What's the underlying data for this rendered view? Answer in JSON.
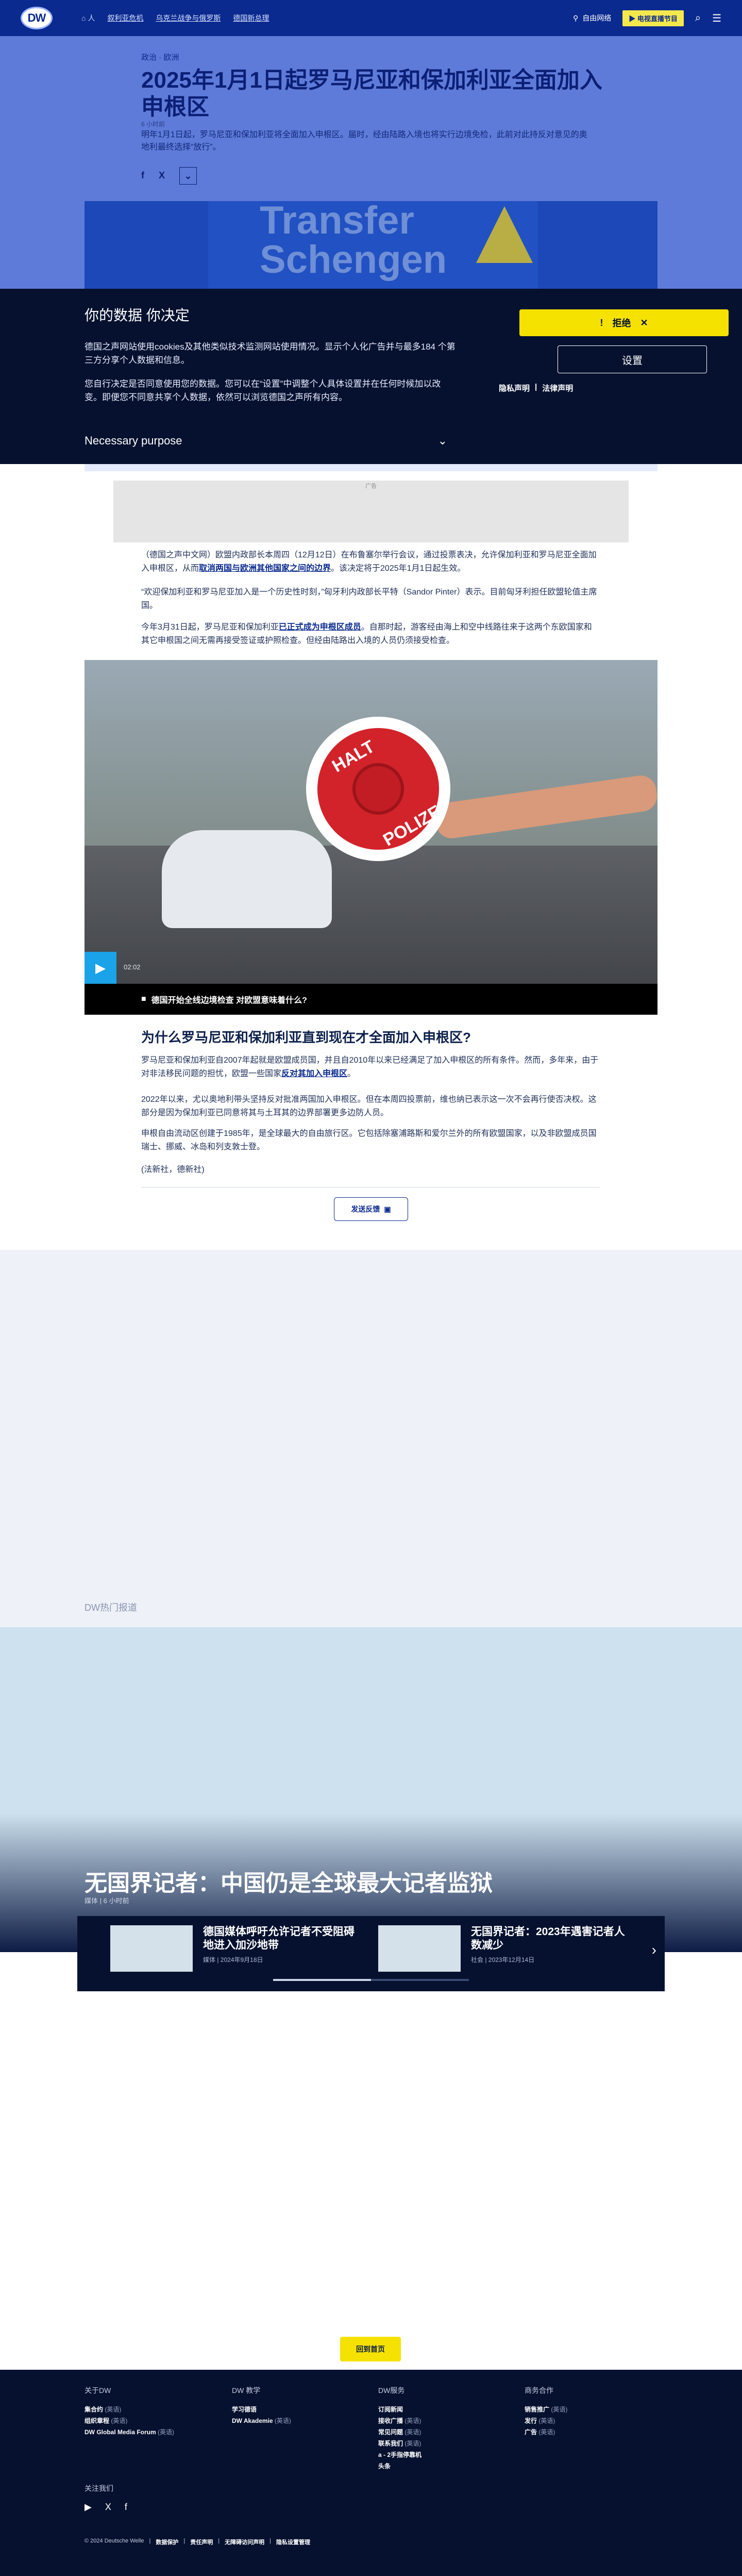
{
  "header": {
    "logo_text": "DW",
    "nav_home": "⌂ 人",
    "nav_links": [
      "叙利亚危机",
      "乌克兰战争与俄罗斯",
      "德国新总理"
    ],
    "language_label": "自由网络",
    "live_button": "电视直播节目",
    "icons": [
      "search-icon",
      "menu-icon"
    ]
  },
  "hero": {
    "kicker": "政治 · 欧洲",
    "headline": "2025年1月1日起罗马尼亚和保加利亚全面加入申根区",
    "date": "6 小时前",
    "teaser": "明年1月1日起，罗马尼亚和保加利亚将全面加入申根区。届时，经由陆路入境也将实行边境免检，此前对此持反对意见的奥地利最终选择“放行”。",
    "share": [
      "f",
      "X",
      "⌄"
    ],
    "image_text": "Transfer Schengen"
  },
  "cookie": {
    "title": "你的数据 你决定",
    "text1": "德国之声网站使用cookies及其他类似技术监测网站使用情况。显示个人化广告并与最多184 个第三方分享个人数据和信息。",
    "text2": "您自行决定是否同意使用您的数据。您可以在“设置”中调整个人具体设置并在任何时候加以改变。即便您不同意共享个人数据，依然可以浏览德国之声所有内容。",
    "reject_button": "拒绝",
    "settings_button": "设置",
    "links": [
      "隐私声明",
      "法律声明"
    ],
    "purpose_label": "Necessary purpose"
  },
  "article": {
    "ad_label": "广告",
    "paragraphs": [
      {
        "text": "（德国之声中文网）欧盟内政部长本周四（12月12日）在布鲁塞尔举行会议，通过投票表决，允许保加利亚和罗马尼亚全面加入申根区，从而",
        "link": "取消两国与欧洲其他国家之间的边界",
        "after": "。该决定将于2025年1月1日起生效。"
      },
      {
        "text": "“欢迎保加利亚和罗马尼亚加入是一个历史性时刻，”匈牙利内政部长平特（Sandor Pinter）表示。目前匈牙利担任欧盟轮值主席国。",
        "link": "",
        "after": ""
      },
      {
        "text": "今年3月31日起，罗马尼亚和保加利亚",
        "link": "已正式成为申根区成员",
        "after": "。自那时起，游客经由海上和空中线路往来于这两个东欧国家和其它申根国之间无需再接受签证或护照检查。但经由陆路出入境的人员仍须接受检查。"
      }
    ],
    "video": {
      "duration": "02:02",
      "caption": "德国开始全线边境检查 对欧盟意味着什么?",
      "sign_top": "HALT",
      "sign_bottom": "POLIZEI"
    },
    "subheading": "为什么罗马尼亚和保加利亚直到现在才全面加入申根区?",
    "paragraphs2": [
      {
        "text": "罗马尼亚和保加利亚自2007年起就是欧盟成员国，并且自2010年以来已经满足了加入申根区的所有条件。然而，多年来，由于对非法移民问题的担忧，欧盟一些国家",
        "link": "反对其加入申根区",
        "after": "。"
      },
      {
        "text": "2022年以来，尤以奥地利带头坚持反对批准两国加入申根区。但在本周四投票前，维也纳已表示这一次不会再行使否决权。这部分是因为保加利亚已同意将其与土耳其的边界部署更多边防人员。",
        "link": "",
        "after": ""
      },
      {
        "text": "申根自由流动区创建于1985年，是全球最大的自由旅行区。它包括除塞浦路斯和爱尔兰外的所有欧盟国家，以及非欧盟成员国瑞士、挪威、冰岛和列支敦士登。",
        "link": "",
        "after": ""
      },
      {
        "text": "(法新社，德新社)",
        "link": "",
        "after": ""
      }
    ],
    "feedback_button": "发送反馈"
  },
  "related": {
    "section_label": "DW热门报道",
    "feature_title": "无国界记者：中国仍是全球最大记者监狱",
    "feature_meta": "媒体 | 6 小时前",
    "cards": [
      {
        "title": "德国媒体呼吁允许记者不受阻碍地进入加沙地带",
        "meta": "媒体 | 2024年9月18日"
      },
      {
        "title": "无国界记者：2023年遇害记者人数减少",
        "meta": "社会 | 2023年12月14日"
      }
    ],
    "carousel_progress": 0.5
  },
  "back_to_top": "回到首页",
  "footer": {
    "columns": [
      {
        "head": "关于DW",
        "items": [
          {
            "label": "集合约",
            "note": "(英语)"
          },
          {
            "label": "组织章程",
            "note": "(英语)"
          },
          {
            "label": "DW Global Media Forum",
            "note": "(英语)"
          }
        ]
      },
      {
        "head": "DW 教学",
        "items": [
          {
            "label": "学习德语",
            "note": ""
          },
          {
            "label": "DW Akademie",
            "note": "(英语)"
          }
        ]
      },
      {
        "head": "DW服务",
        "items": [
          {
            "label": "订阅新闻",
            "note": ""
          },
          {
            "label": "接收广播",
            "note": "(英语)"
          },
          {
            "label": "常见问题",
            "note": "(英语)"
          },
          {
            "label": "联系我们",
            "note": "(英语)"
          },
          {
            "label": "a - 2手指停靠机",
            "note": ""
          },
          {
            "label": "头条",
            "note": ""
          }
        ]
      },
      {
        "head": "商务合作",
        "items": [
          {
            "label": "销售推广",
            "note": "(英语)"
          },
          {
            "label": "发行",
            "note": "(英语)"
          },
          {
            "label": "广告",
            "note": "(英语)"
          }
        ]
      }
    ],
    "follow_label": "关注我们",
    "social": [
      "youtube-icon",
      "x-icon",
      "facebook-icon"
    ],
    "legal": {
      "copyright": "© 2024 Deutsche Welle",
      "links": [
        "数据保护",
        "责任声明",
        "无障碍访问声明",
        "隐私设置管理"
      ]
    }
  }
}
